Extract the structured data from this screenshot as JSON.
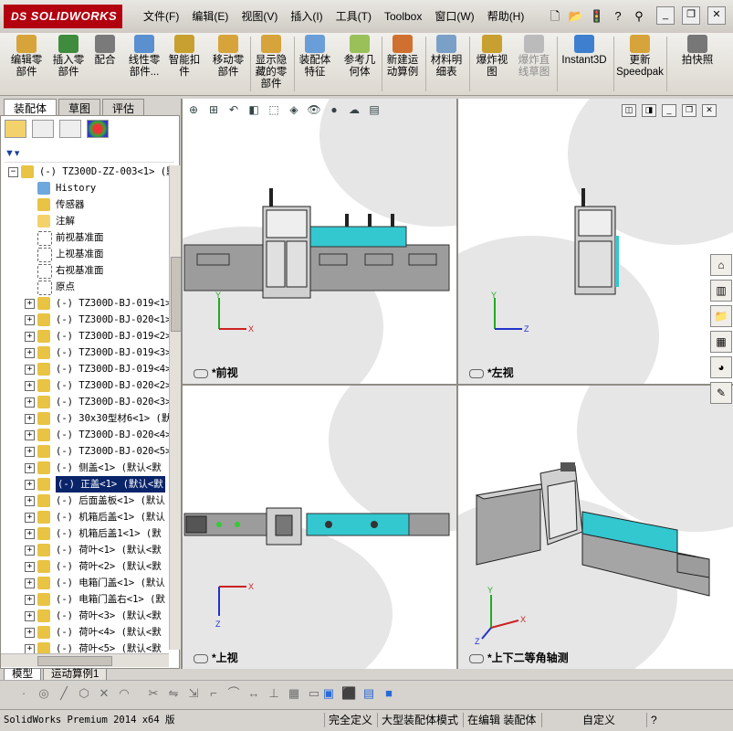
{
  "app": {
    "logo_prefix": "DS",
    "logo_text": "SOLIDWORKS",
    "menu": [
      "文件(F)",
      "编辑(E)",
      "视图(V)",
      "插入(I)",
      "工具(T)",
      "Toolbox",
      "窗口(W)",
      "帮助(H)"
    ]
  },
  "command_manager": {
    "items": [
      {
        "label": "编辑零\n部件",
        "icon": "edit-component-icon",
        "disabled": false
      },
      {
        "label": "插入零\n部件",
        "icon": "insert-component-icon",
        "disabled": false
      },
      {
        "label": "配合",
        "icon": "mate-icon",
        "disabled": false
      },
      {
        "label": "线性零\n部件...",
        "icon": "linear-pattern-icon",
        "disabled": false
      },
      {
        "label": "智能扣\n件",
        "icon": "smart-fastener-icon",
        "disabled": false
      },
      {
        "label": "移动零\n部件",
        "icon": "move-component-icon",
        "disabled": false
      },
      {
        "label": "显示隐\n藏的零\n部件",
        "icon": "show-hidden-icon",
        "disabled": false
      },
      {
        "label": "装配体\n特征",
        "icon": "assembly-feature-icon",
        "disabled": false
      },
      {
        "label": "参考几\n何体",
        "icon": "reference-geometry-icon",
        "disabled": false
      },
      {
        "label": "新建运\n动算例",
        "icon": "motion-study-icon",
        "disabled": false
      },
      {
        "label": "材料明\n细表",
        "icon": "bom-icon",
        "disabled": false
      },
      {
        "label": "爆炸视\n图",
        "icon": "exploded-view-icon",
        "disabled": false
      },
      {
        "label": "爆炸直\n线草图",
        "icon": "explode-line-icon",
        "disabled": true
      },
      {
        "label": "Instant3D",
        "icon": "instant3d-icon",
        "disabled": false
      },
      {
        "label": "更新\nSpeedpak",
        "icon": "speedpak-icon",
        "disabled": false
      },
      {
        "label": "拍快照",
        "icon": "snapshot-icon",
        "disabled": false
      }
    ]
  },
  "panel_tabs": [
    "装配体",
    "草图",
    "评估"
  ],
  "feature_tree": {
    "root": "(-) TZ300D-ZZ-003<1> (默",
    "items": [
      {
        "text": "History",
        "icon": "history-icon",
        "expand": ""
      },
      {
        "text": "传感器",
        "icon": "sensor-icon",
        "expand": ""
      },
      {
        "text": "注解",
        "icon": "annotation-icon",
        "expand": ""
      },
      {
        "text": "前视基准面",
        "icon": "plane-icon",
        "expand": ""
      },
      {
        "text": "上视基准面",
        "icon": "plane-icon",
        "expand": ""
      },
      {
        "text": "右视基准面",
        "icon": "plane-icon",
        "expand": ""
      },
      {
        "text": "原点",
        "icon": "origin-icon",
        "expand": ""
      },
      {
        "text": "(-) TZ300D-BJ-019<1>",
        "icon": "subassembly-icon",
        "expand": "+"
      },
      {
        "text": "(-) TZ300D-BJ-020<1>",
        "icon": "subassembly-icon",
        "expand": "+"
      },
      {
        "text": "(-) TZ300D-BJ-019<2>",
        "icon": "subassembly-icon",
        "expand": "+"
      },
      {
        "text": "(-) TZ300D-BJ-019<3>",
        "icon": "subassembly-icon",
        "expand": "+"
      },
      {
        "text": "(-) TZ300D-BJ-019<4>",
        "icon": "subassembly-icon",
        "expand": "+"
      },
      {
        "text": "(-) TZ300D-BJ-020<2>",
        "icon": "subassembly-icon",
        "expand": "+"
      },
      {
        "text": "(-) TZ300D-BJ-020<3>",
        "icon": "subassembly-icon",
        "expand": "+"
      },
      {
        "text": "(-) 30x30型材6<1> (默",
        "icon": "subassembly-icon",
        "expand": "+"
      },
      {
        "text": "(-) TZ300D-BJ-020<4>",
        "icon": "subassembly-icon",
        "expand": "+"
      },
      {
        "text": "(-) TZ300D-BJ-020<5>",
        "icon": "subassembly-icon",
        "expand": "+"
      },
      {
        "text": "(-) 侧盖<1> (默认<默",
        "icon": "subassembly-icon",
        "expand": "+"
      },
      {
        "text": "(-) 正盖<1> (默认<默",
        "icon": "part-icon",
        "expand": "+",
        "selected": true
      },
      {
        "text": "(-) 后面盖板<1> (默认",
        "icon": "subassembly-icon",
        "expand": "+"
      },
      {
        "text": "(-) 机箱后盖<1> (默认",
        "icon": "subassembly-icon",
        "expand": "+"
      },
      {
        "text": "(-) 机箱后盖1<1> (默",
        "icon": "subassembly-icon",
        "expand": "+"
      },
      {
        "text": "(-) 荷叶<1> (默认<默",
        "icon": "subassembly-icon",
        "expand": "+"
      },
      {
        "text": "(-) 荷叶<2> (默认<默",
        "icon": "subassembly-icon",
        "expand": "+"
      },
      {
        "text": "(-) 电箱门盖<1> (默认",
        "icon": "subassembly-icon",
        "expand": "+"
      },
      {
        "text": "(-) 电箱门盖右<1> (默",
        "icon": "subassembly-icon",
        "expand": "+"
      },
      {
        "text": "(-) 荷叶<3> (默认<默",
        "icon": "subassembly-icon",
        "expand": "+"
      },
      {
        "text": "(-) 荷叶<4> (默认<默",
        "icon": "subassembly-icon",
        "expand": "+"
      },
      {
        "text": "(-) 荷叶<5> (默认<默",
        "icon": "subassembly-icon",
        "expand": "+"
      }
    ]
  },
  "bottom_tabs": [
    "模型",
    "运动算例1"
  ],
  "views": {
    "front": "*前视",
    "left": "*左视",
    "top": "*上视",
    "iso": "*上下二等角轴测"
  },
  "axes": {
    "x": "X",
    "y": "Y",
    "z": "Z"
  },
  "status": {
    "product": "SolidWorks Premium 2014 x64 版",
    "defined": "完全定义",
    "mode": "大型装配体模式",
    "editing": "在编辑 装配体",
    "custom": "自定义",
    "help": "?"
  },
  "colors": {
    "accent_red": "#b3000f",
    "teal": "#33c7d0",
    "machine_gray": "#9c9c9c",
    "selection": "#0a246a"
  }
}
